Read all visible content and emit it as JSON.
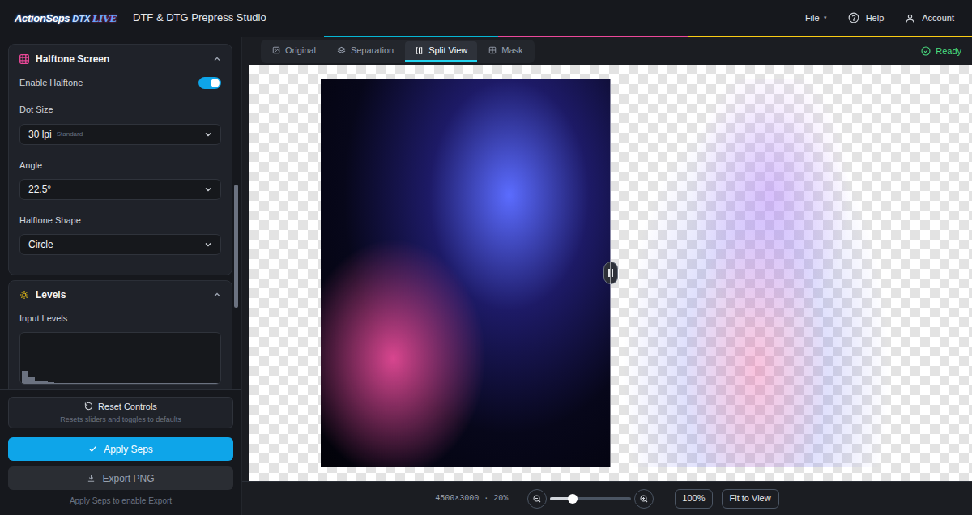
{
  "header": {
    "logo": {
      "name": "ActionSeps",
      "edition": "DTX",
      "badge": "LIVE"
    },
    "title": "DTF & DTG Prepress Studio",
    "menu": [
      {
        "label": "File",
        "caret": "▾"
      },
      {
        "label": "Help"
      },
      {
        "label": "Account"
      }
    ]
  },
  "halftone": {
    "title": "Halftone Screen",
    "expanded": true,
    "enable": {
      "label": "Enable Halftone",
      "on": true
    },
    "fields": [
      {
        "label": "Dot Size",
        "value": "30 lpi",
        "hint": "Standard"
      },
      {
        "label": "Angle",
        "value": "22.5°"
      },
      {
        "label": "Halftone Shape",
        "value": "Circle"
      }
    ]
  },
  "levels": {
    "title": "Levels",
    "expanded": true,
    "input_label": "Input Levels",
    "histogram": [
      26,
      14,
      7,
      4,
      3,
      2,
      2,
      1,
      1,
      1,
      1,
      1,
      1,
      1,
      1,
      1,
      1,
      1,
      1,
      1,
      1,
      1,
      1,
      1,
      1,
      1,
      1,
      1,
      1,
      1
    ]
  },
  "actions": {
    "reset": {
      "label": "Reset Controls",
      "hint": "Resets sliders and toggles to defaults"
    },
    "apply": {
      "label": "Apply Seps"
    },
    "export": {
      "label": "Export PNG",
      "disabled": true
    },
    "note": "Apply Seps to enable Export"
  },
  "view_tabs": [
    {
      "label": "Original",
      "selected": false
    },
    {
      "label": "Separation",
      "selected": false
    },
    {
      "label": "Split View",
      "selected": true
    },
    {
      "label": "Mask",
      "selected": false
    }
  ],
  "status": {
    "label": "Ready",
    "ready": true
  },
  "canvas": {
    "split": 0.5
  },
  "footer": {
    "info": "4500×3000 · 20%",
    "zoom": {
      "level": 0.28
    },
    "buttons": [
      "100%",
      "Fit to View"
    ]
  }
}
